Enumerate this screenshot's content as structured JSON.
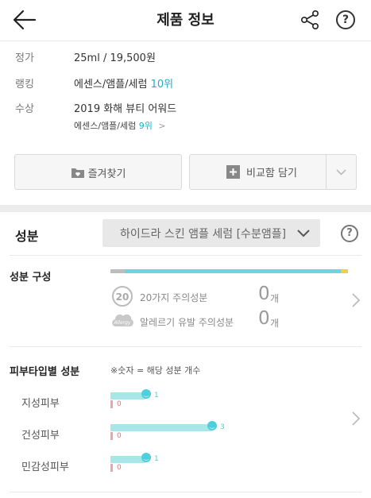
{
  "header": {
    "title": "제품 정보",
    "help": "?"
  },
  "info": {
    "price_label": "정가",
    "price_value": "25ml / 19,500원",
    "rank_label": "랭킹",
    "rank_category": "에센스/앰플/세럼",
    "rank_value": "10위",
    "award_label": "수상",
    "award_value": "2019 화해 뷰티 어워드",
    "award_category": "에센스/앰플/세럼",
    "award_rank": "9위",
    "award_chevron": ">"
  },
  "actions": {
    "favorite_label": "즐겨찾기",
    "compare_label": "비교함 담기"
  },
  "ingredients": {
    "section_title": "성분",
    "selected_product": "하이드라 스킨 앰플 세럼 [수분앰플]",
    "help": "?",
    "composition_title": "성분 구성",
    "composition_bar": [
      {
        "color": "#bdbdbd",
        "share": 0.06
      },
      {
        "color": "#6fd5dd",
        "share": 0.91
      },
      {
        "color": "#f4cf3b",
        "share": 0.03
      }
    ],
    "caution_20_badge": "20",
    "caution_20_label": "20가지 주의성분",
    "caution_20_count": "0",
    "allergy_badge": "Allergy",
    "allergy_label": "알레르기 유발 주의성분",
    "allergy_count": "0",
    "count_unit": "개"
  },
  "skin_type": {
    "title": "피부타입별 성분",
    "note": "※숫자 = 해당 성분 개수",
    "max": 3,
    "rows": [
      {
        "label": "지성피부",
        "positive": "1",
        "negative": "0"
      },
      {
        "label": "건성피부",
        "positive": "3",
        "negative": "0"
      },
      {
        "label": "민감성피부",
        "positive": "1",
        "negative": "0"
      }
    ]
  }
}
